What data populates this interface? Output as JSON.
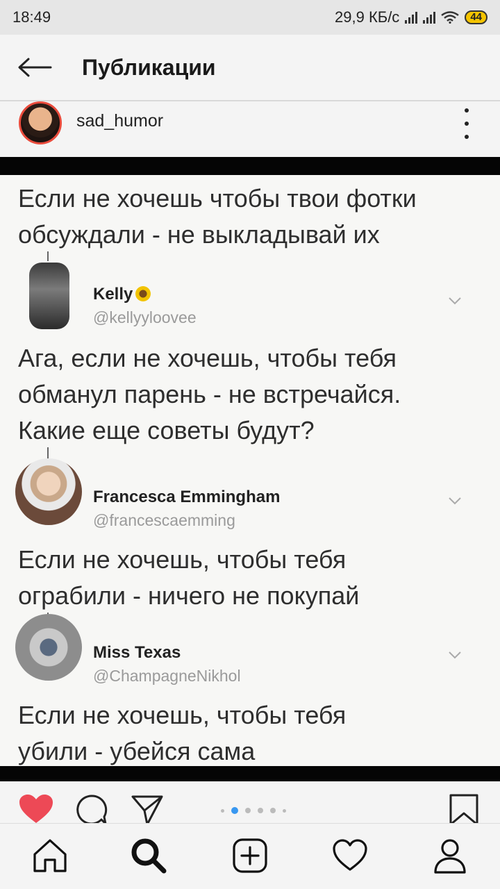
{
  "status": {
    "time": "18:49",
    "network_speed": "29,9 КБ/с",
    "battery": "44"
  },
  "appbar": {
    "title": "Публикации",
    "back_icon": "arrow-left-icon"
  },
  "post": {
    "author": "sad_humor",
    "more_icon": "more-vertical-icon",
    "image": {
      "intro_text": "Если не хочешь чтобы твои фотки\nобсуждали - не выкладывай их",
      "replies": [
        {
          "name": "Kelly",
          "handle": "@kellyyloovee",
          "text": "Ага, если не хочешь, чтобы тебя\nобманул парень - не встречайся.\nКакие еще советы будут?"
        },
        {
          "name": "Francesca Emmingham",
          "handle": "@francescaemming",
          "text": "Если не хочешь, чтобы тебя\nограбили - ничего не покупай"
        },
        {
          "name": "Miss Texas",
          "handle": "@ChampagneNikhol",
          "text": "Если не хочешь, чтобы тебя\nубили - убейся сама"
        }
      ]
    },
    "actions": {
      "like_icon": "heart-filled-icon",
      "comment_icon": "comment-icon",
      "share_icon": "send-icon",
      "save_icon": "bookmark-icon",
      "carousel_pages": 6,
      "carousel_active": 2
    }
  },
  "bottom_nav": [
    "home-icon",
    "search-icon",
    "add-post-icon",
    "activity-heart-icon",
    "profile-icon"
  ],
  "colors": {
    "like": "#ed4956",
    "carousel_active": "#3897f0",
    "status_battery": "#f5c400"
  }
}
